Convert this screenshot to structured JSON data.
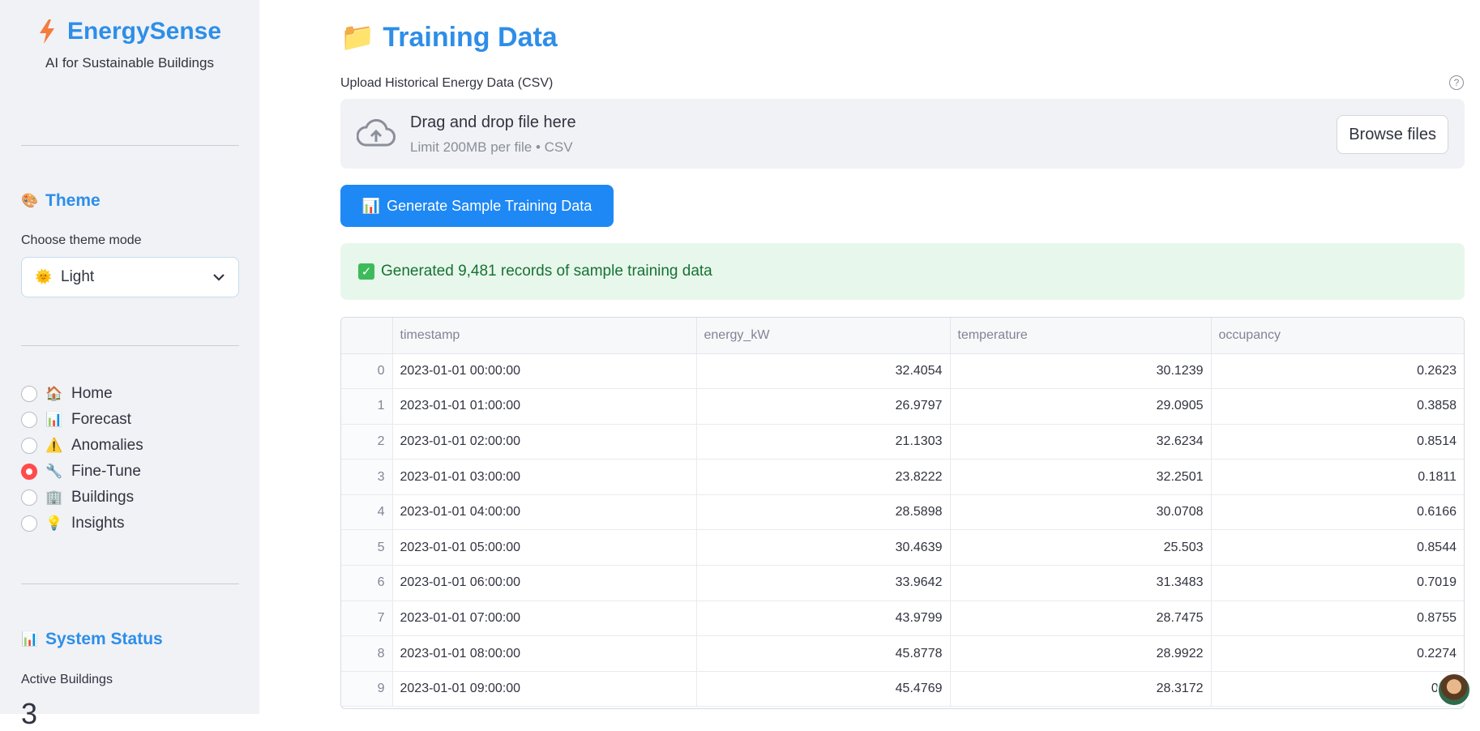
{
  "sidebar": {
    "app_title": "EnergySense",
    "app_subtitle": "AI for Sustainable Buildings",
    "theme": {
      "section_title": "Theme",
      "section_icon": "🎨",
      "label": "Choose theme mode",
      "selected_icon": "🌞",
      "selected_value": "Light"
    },
    "nav": [
      {
        "icon": "🏠",
        "label": "Home",
        "selected": false
      },
      {
        "icon": "📊",
        "label": "Forecast",
        "selected": false
      },
      {
        "icon": "⚠️",
        "label": "Anomalies",
        "selected": false
      },
      {
        "icon": "🔧",
        "label": "Fine-Tune",
        "selected": true
      },
      {
        "icon": "🏢",
        "label": "Buildings",
        "selected": false
      },
      {
        "icon": "💡",
        "label": "Insights",
        "selected": false
      }
    ],
    "status": {
      "section_title": "System Status",
      "section_icon": "📊",
      "active_buildings_label": "Active Buildings",
      "active_buildings_value": "3"
    }
  },
  "main": {
    "page_icon": "📁",
    "page_title": "Training Data",
    "upload": {
      "label": "Upload Historical Energy Data (CSV)",
      "help": "?",
      "drop_title": "Drag and drop file here",
      "drop_sub": "Limit 200MB per file • CSV",
      "browse_label": "Browse files"
    },
    "generate_button": {
      "icon": "📊",
      "label": "Generate Sample Training Data"
    },
    "success_message": "Generated 9,481 records of sample training data",
    "table": {
      "columns": [
        "",
        "timestamp",
        "energy_kW",
        "temperature",
        "occupancy"
      ],
      "rows": [
        [
          "0",
          "2023-01-01 00:00:00",
          "32.4054",
          "30.1239",
          "0.2623"
        ],
        [
          "1",
          "2023-01-01 01:00:00",
          "26.9797",
          "29.0905",
          "0.3858"
        ],
        [
          "2",
          "2023-01-01 02:00:00",
          "21.1303",
          "32.6234",
          "0.8514"
        ],
        [
          "3",
          "2023-01-01 03:00:00",
          "23.8222",
          "32.2501",
          "0.1811"
        ],
        [
          "4",
          "2023-01-01 04:00:00",
          "28.5898",
          "30.0708",
          "0.6166"
        ],
        [
          "5",
          "2023-01-01 05:00:00",
          "30.4639",
          "25.503",
          "0.8544"
        ],
        [
          "6",
          "2023-01-01 06:00:00",
          "33.9642",
          "31.3483",
          "0.7019"
        ],
        [
          "7",
          "2023-01-01 07:00:00",
          "43.9799",
          "28.7475",
          "0.8755"
        ],
        [
          "8",
          "2023-01-01 08:00:00",
          "45.8778",
          "28.9922",
          "0.2274"
        ],
        [
          "9",
          "2023-01-01 09:00:00",
          "45.4769",
          "28.3172",
          "0.66"
        ]
      ]
    }
  },
  "colors": {
    "accent": "#2e8ee8",
    "primary_button": "#1e88f5",
    "radio_selected": "#ff4b4b",
    "success_bg": "#e8f7ec",
    "success_text": "#177233"
  }
}
